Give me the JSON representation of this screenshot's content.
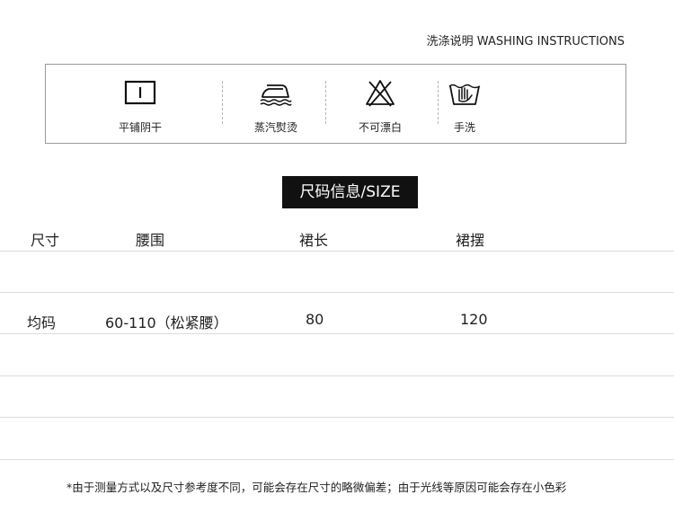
{
  "washing": {
    "title": "洗涤说明 WASHING INSTRUCTIONS",
    "items": [
      {
        "icon": "flat-dry-icon",
        "label": "平铺阴干"
      },
      {
        "icon": "steam-iron-icon",
        "label": "蒸汽熨烫"
      },
      {
        "icon": "no-bleach-icon",
        "label": "不可漂白"
      },
      {
        "icon": "hand-wash-icon",
        "label": "手洗"
      }
    ]
  },
  "size": {
    "header": "尺码信息/SIZE",
    "columns": [
      "尺寸",
      "腰围",
      "裙长",
      "裙摆"
    ],
    "rows": [
      [
        "均码",
        "60-110（松紧腰）",
        "80",
        "120"
      ]
    ]
  },
  "note": "*由于测量方式以及尺寸参考度不同，可能会存在尺寸的略微偏差；由于光线等原因可能会存在小色彩"
}
